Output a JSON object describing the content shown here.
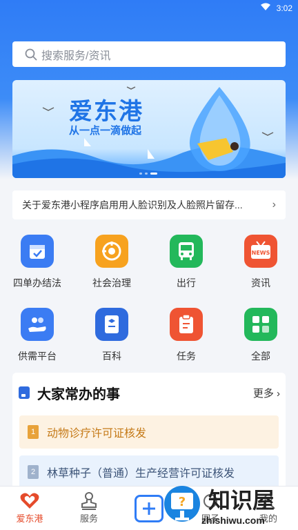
{
  "status": {
    "time": "3:02",
    "wifi_icon": "wifi-icon"
  },
  "search": {
    "placeholder": "搜索服务/资讯"
  },
  "banner": {
    "brand": "爱东港",
    "slogan": "从一点一滴做起"
  },
  "notice": {
    "text": "关于爱东港小程序启用用人脸识别及人脸照片留存...",
    "chevron": "›"
  },
  "grid": {
    "items": [
      {
        "label": "四单办结法",
        "icon": "calendar-check-icon",
        "color": "#3b7cf3"
      },
      {
        "label": "社会治理",
        "icon": "target-icon",
        "color": "#f7a21f"
      },
      {
        "label": "出行",
        "icon": "bus-icon",
        "color": "#23b85b"
      },
      {
        "label": "资讯",
        "icon": "news-tv-icon",
        "color": "#ef5433"
      },
      {
        "label": "供需平台",
        "icon": "hand-people-icon",
        "color": "#3b7cf3"
      },
      {
        "label": "百科",
        "icon": "book-icon",
        "color": "#2f6bde"
      },
      {
        "label": "任务",
        "icon": "clipboard-icon",
        "color": "#ef5433"
      },
      {
        "label": "全部",
        "icon": "all-apps-icon",
        "color": "#23b85b"
      }
    ]
  },
  "section": {
    "title": "大家常办的事",
    "more": "更多 ›",
    "tasks": [
      {
        "num": "1",
        "label": "动物诊疗许可证核发"
      },
      {
        "num": "2",
        "label": "林草种子（普通）生产经营许可证核发"
      }
    ]
  },
  "tabbar": {
    "tabs": [
      {
        "label": "爱东港",
        "icon": "heart-icon"
      },
      {
        "label": "服务",
        "icon": "stamp-icon"
      },
      {
        "label": "",
        "icon": "plus-icon"
      },
      {
        "label": "圈子",
        "icon": "circle-icon"
      },
      {
        "label": "我的",
        "icon": "user-icon"
      }
    ]
  },
  "watermark": {
    "text": "知识屋",
    "url": "zhishiwu.com"
  },
  "colors": {
    "primary": "#2f7cf6",
    "active_tab": "#e54b2b"
  }
}
